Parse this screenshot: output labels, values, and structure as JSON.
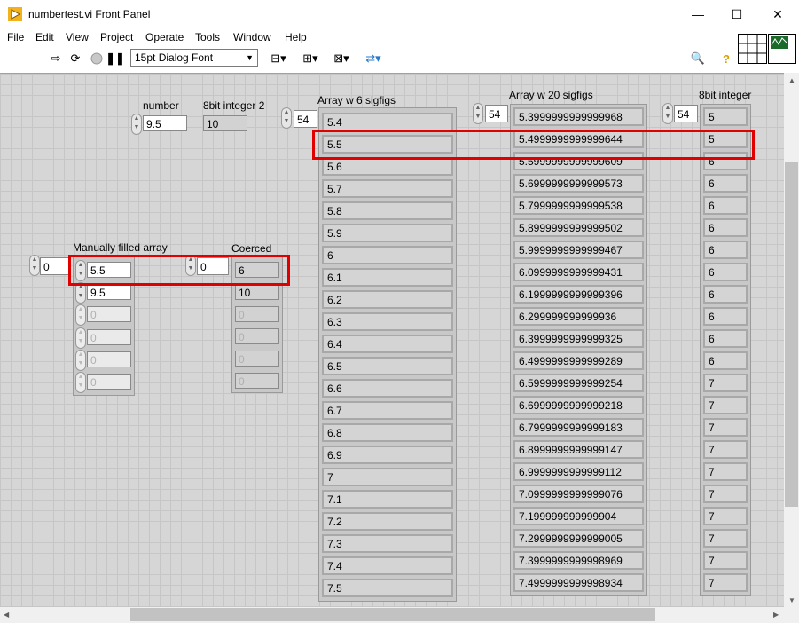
{
  "window": {
    "title": "numbertest.vi Front Panel",
    "minimize": "—",
    "maximize": "☐",
    "close": "✕"
  },
  "menu": [
    "File",
    "Edit",
    "View",
    "Project",
    "Operate",
    "Tools",
    "Window",
    "Help"
  ],
  "toolbar": {
    "font": "15pt Dialog Font"
  },
  "number": {
    "label": "number",
    "value": "9.5"
  },
  "int2": {
    "label": "8bit integer 2",
    "value": "10"
  },
  "manual": {
    "label": "Manually filled array",
    "index": "0",
    "values": [
      "5.5",
      "9.5",
      "0",
      "0",
      "0",
      "0"
    ]
  },
  "coerced": {
    "label": "Coerced",
    "index": "0",
    "values": [
      "6",
      "10",
      "0",
      "0",
      "0",
      "0"
    ]
  },
  "arr6": {
    "label": "Array w 6 sigfigs",
    "index": "54",
    "values": [
      "5.4",
      "5.5",
      "5.6",
      "5.7",
      "5.8",
      "5.9",
      "6",
      "6.1",
      "6.2",
      "6.3",
      "6.4",
      "6.5",
      "6.6",
      "6.7",
      "6.8",
      "6.9",
      "7",
      "7.1",
      "7.2",
      "7.3",
      "7.4",
      "7.5"
    ]
  },
  "arr20": {
    "label": "Array w 20 sigfigs",
    "index": "54",
    "values": [
      "5.3999999999999968",
      "5.4999999999999644",
      "5.5999999999999609",
      "5.6999999999999573",
      "5.7999999999999538",
      "5.8999999999999502",
      "5.9999999999999467",
      "6.0999999999999431",
      "6.1999999999999396",
      "6.299999999999936",
      "6.3999999999999325",
      "6.4999999999999289",
      "6.5999999999999254",
      "6.6999999999999218",
      "6.7999999999999183",
      "6.8999999999999147",
      "6.9999999999999112",
      "7.0999999999999076",
      "7.199999999999904",
      "7.2999999999999005",
      "7.3999999999998969",
      "7.4999999999998934"
    ]
  },
  "int8": {
    "label": "8bit integer",
    "index": "54",
    "values": [
      "5",
      "5",
      "6",
      "6",
      "6",
      "6",
      "6",
      "6",
      "6",
      "6",
      "6",
      "6",
      "7",
      "7",
      "7",
      "7",
      "7",
      "7",
      "7",
      "7",
      "7",
      "7"
    ]
  },
  "colors": {
    "panel": "#d6d6d6",
    "highlight": "#e00000"
  }
}
